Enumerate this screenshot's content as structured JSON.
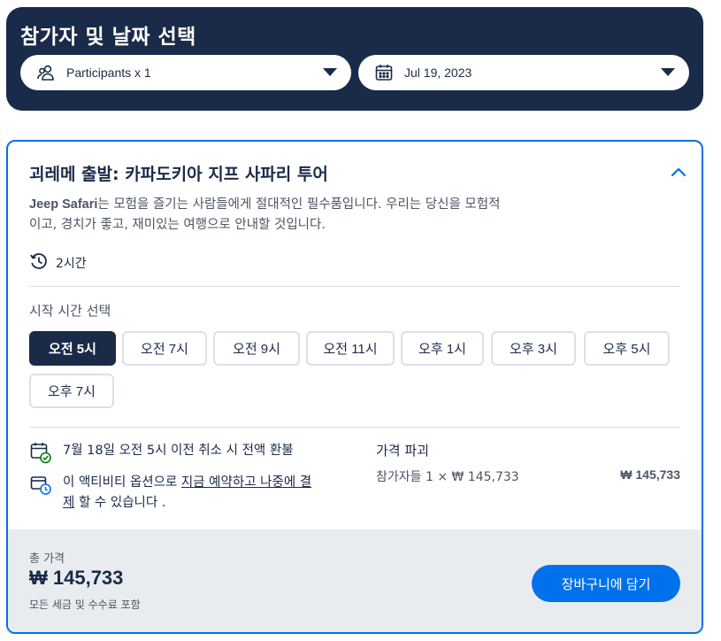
{
  "header": {
    "title": "참가자 및 날짜 선택",
    "participants": "Participants x 1",
    "date": "Jul 19, 2023"
  },
  "option": {
    "title": "괴레메 출발: 카파도키아 지프 사파리 투어",
    "description_brand": "Jeep Safari",
    "description_rest": "는 모험을 즐기는 사람들에게 절대적인 필수품입니다. 우리는 당신을 모험적이고, 경치가 좋고, 재미있는 여행으로 안내할 것입니다.",
    "duration": "2시간",
    "start_time_label": "시작 시간 선택",
    "time_slots": [
      "오전 5시",
      "오전 7시",
      "오전 9시",
      "오전 11시",
      "오후 1시",
      "오후 3시",
      "오후 5시",
      "오후 7시"
    ],
    "selected_slot": "오전 5시",
    "cancellation": "7월 18일 오전 5시 이전 취소 시 전액 환불",
    "reserve_prefix": "이 액티비티 옵션으로 ",
    "reserve_link": "지금 예약하고 나중에 결제",
    "reserve_suffix": " 할 수 있습니다 .",
    "price_breakdown_label": "가격 파괴",
    "price_line_label": "참가자들 1 × ₩ 145,733",
    "price_line_amount": "₩ 145,733"
  },
  "footer": {
    "total_label": "총 가격",
    "total_value": "₩ 145,733",
    "total_note": "모든 세금 및 수수료 포함",
    "cart_button": "장바구니에 담기"
  },
  "colors": {
    "navy": "#1a2b49",
    "accent_blue": "#0071eb",
    "footer_bg": "#e9ecef",
    "check_green": "#008009"
  }
}
